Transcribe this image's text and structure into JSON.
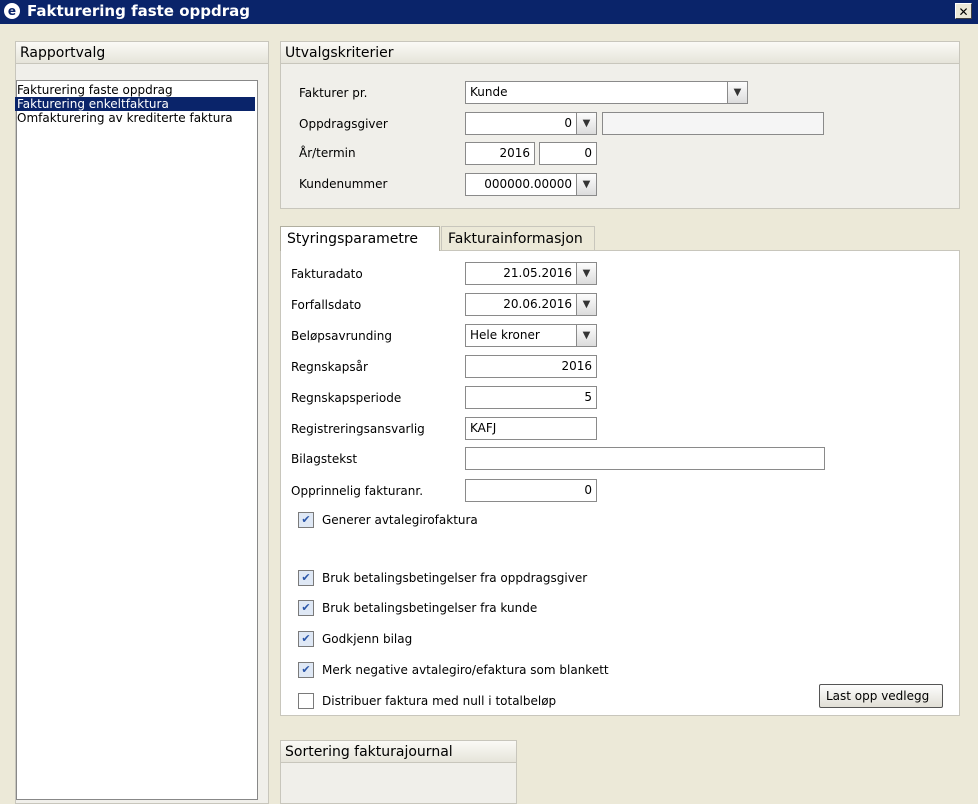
{
  "window": {
    "title": "Fakturering faste oppdrag",
    "close_glyph": "✕",
    "logo_glyph": "e"
  },
  "rapportvalg": {
    "header": "Rapportvalg",
    "items": [
      {
        "label": "Fakturering faste oppdrag",
        "selected": false
      },
      {
        "label": "Fakturering enkeltfaktura",
        "selected": true
      },
      {
        "label": "Omfakturering av krediterte faktura",
        "selected": false
      }
    ]
  },
  "utvalg": {
    "header": "Utvalgskriterier",
    "fakturer_pr_label": "Fakturer pr.",
    "fakturer_pr_value": "Kunde",
    "oppdragsgiver_label": "Oppdragsgiver",
    "oppdragsgiver_value": "0",
    "oppdragsgiver_name": "",
    "aar_termin_label": "År/termin",
    "aar_value": "2016",
    "termin_value": "0",
    "kundenummer_label": "Kundenummer",
    "kundenummer_value": "000000.00000"
  },
  "tabs": {
    "styring": "Styringsparametre",
    "fakturainfo": "Fakturainformasjon"
  },
  "styring": {
    "fakturadato_label": "Fakturadato",
    "fakturadato_value": "21.05.2016",
    "forfallsdato_label": "Forfallsdato",
    "forfallsdato_value": "20.06.2016",
    "belop_label": "Beløpsavrunding",
    "belop_value": "Hele kroner",
    "regnskapsaar_label": "Regnskapsår",
    "regnskapsaar_value": "2016",
    "regnskapsperiode_label": "Regnskapsperiode",
    "regnskapsperiode_value": "5",
    "registrering_label": "Registreringsansvarlig",
    "registrering_value": "KAFJ",
    "bilagstekst_label": "Bilagstekst",
    "bilagstekst_value": "",
    "opprinnelig_label": "Opprinnelig fakturanr.",
    "opprinnelig_value": "0",
    "checkboxes": [
      {
        "label": "Generer avtalegirofaktura",
        "checked": true
      },
      {
        "label": "Bruk betalingsbetingelser fra oppdragsgiver",
        "checked": true
      },
      {
        "label": "Bruk betalingsbetingelser fra kunde",
        "checked": true
      },
      {
        "label": "Godkjenn bilag",
        "checked": true
      },
      {
        "label": "Merk negative avtalegiro/efaktura som blankett",
        "checked": true
      },
      {
        "label": "Distribuer faktura med null i totalbeløp",
        "checked": false
      }
    ],
    "check_glyph": "✔",
    "last_opp_button": "Last opp vedlegg"
  },
  "sortering": {
    "header": "Sortering fakturajournal"
  },
  "icons": {
    "dropdown": "chevron-down-icon",
    "dropdown_glyph": "▼"
  }
}
